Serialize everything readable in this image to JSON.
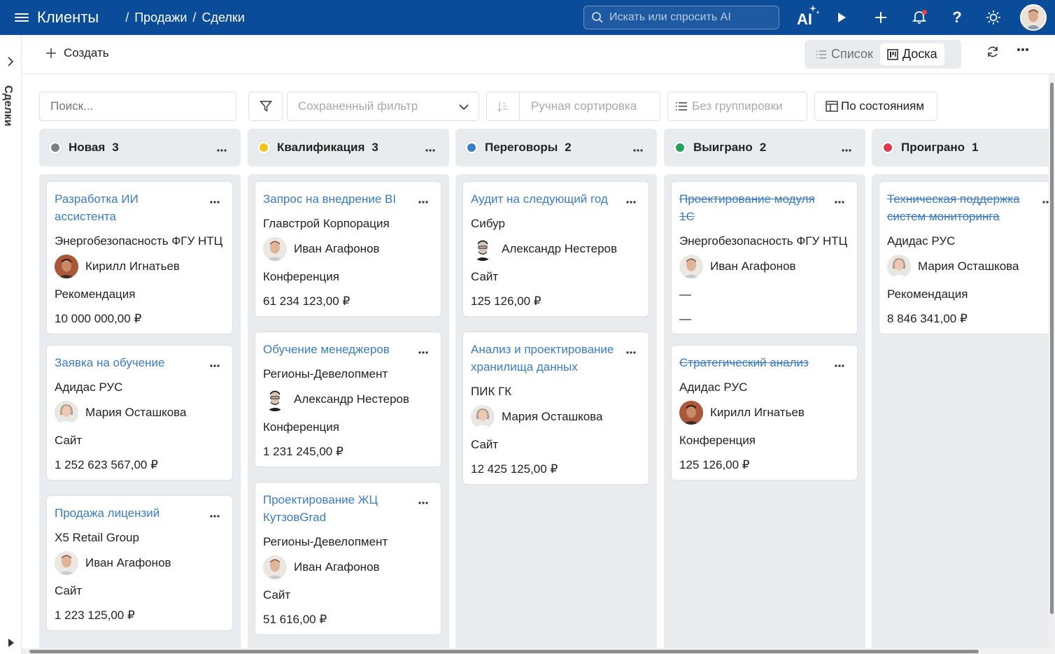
{
  "header": {
    "app_title": "Клиенты",
    "breadcrumb": [
      "Продажи",
      "Сделки"
    ],
    "breadcrumb_sep": "/",
    "search_placeholder": "Искать или спросить AI",
    "ai_label": "AI"
  },
  "rail": {
    "label": "Сделки"
  },
  "toolbar": {
    "create_label": "Создать",
    "view_list": "Список",
    "view_board": "Доска",
    "active_view": "Доска"
  },
  "filters": {
    "search_placeholder": "Поиск...",
    "saved_filter": "Сохраненный фильтр",
    "sort": "Ручная сортировка",
    "grouping": "Без группировки",
    "by_state": "По состояниям"
  },
  "columns": [
    {
      "title": "Новая",
      "count": "3",
      "color": "#7a7f85",
      "cards": [
        {
          "title": "Разработка ИИ ассистента",
          "company": "Энергобезопасность ФГУ НТЦ",
          "person": "Кирилл Игнатьев",
          "avatar": "kirill",
          "source": "Рекомендация",
          "amount": "10 000 000,00 ₽",
          "closed": false
        },
        {
          "title": "Заявка на обучение",
          "company": "Адидас РУС",
          "person": "Мария Осташкова",
          "avatar": "maria",
          "source": "Сайт",
          "amount": "1 252 623 567,00 ₽",
          "closed": false
        },
        {
          "title": "Продажа лицензий",
          "company": "X5 Retail Group",
          "person": "Иван Агафонов",
          "avatar": "ivan",
          "source": "Сайт",
          "amount": "1 223 125,00 ₽",
          "closed": false
        }
      ]
    },
    {
      "title": "Квалификация",
      "count": "3",
      "color": "#f5c11a",
      "cards": [
        {
          "title": "Запрос на внедрение BI",
          "company": "Главстрой Корпорация",
          "person": "Иван Агафонов",
          "avatar": "ivan",
          "source": "Конференция",
          "amount": "61 234 123,00 ₽",
          "closed": false
        },
        {
          "title": "Обучение менеджеров",
          "company": "Регионы-Девелопмент",
          "person": "Александр Нестеров",
          "avatar": "alex",
          "source": "Конференция",
          "amount": "1 231 245,00 ₽",
          "closed": false
        },
        {
          "title": "Проектирование ЖЦ КутзовGrad",
          "company": "Регионы-Девелопмент",
          "person": "Иван Агафонов",
          "avatar": "ivan",
          "source": "Сайт",
          "amount": "51 616,00 ₽",
          "closed": false
        }
      ]
    },
    {
      "title": "Переговоры",
      "count": "2",
      "color": "#3c7dc9",
      "cards": [
        {
          "title": "Аудит на следующий год",
          "company": "Сибур",
          "person": "Александр Нестеров",
          "avatar": "alex",
          "source": "Сайт",
          "amount": "125 126,00 ₽",
          "closed": false
        },
        {
          "title": "Анализ и проектирование хранилища данных",
          "company": "ПИК ГК",
          "person": "Мария Осташкова",
          "avatar": "maria",
          "source": "Сайт",
          "amount": "12 425 125,00 ₽",
          "closed": false
        }
      ]
    },
    {
      "title": "Выиграно",
      "count": "2",
      "color": "#21a35a",
      "cards": [
        {
          "title": "Проектирование модуля 1С",
          "company": "Энергобезопасность ФГУ НТЦ",
          "person": "Иван Агафонов",
          "avatar": "ivan",
          "source": "—",
          "amount": "—",
          "closed": true
        },
        {
          "title": "Стратегический анализ",
          "company": "Адидас РУС",
          "person": "Кирилл Игнатьев",
          "avatar": "kirill",
          "source": "Конференция",
          "amount": "125 126,00 ₽",
          "closed": true
        }
      ]
    },
    {
      "title": "Проиграно",
      "count": "1",
      "color": "#e23a4a",
      "cards": [
        {
          "title": "Техническая поддержка систем мониторинга",
          "company": "Адидас РУС",
          "person": "Мария Осташкова",
          "avatar": "maria",
          "source": "Рекомендация",
          "amount": "8 846 341,00 ₽",
          "closed": true
        }
      ]
    }
  ]
}
